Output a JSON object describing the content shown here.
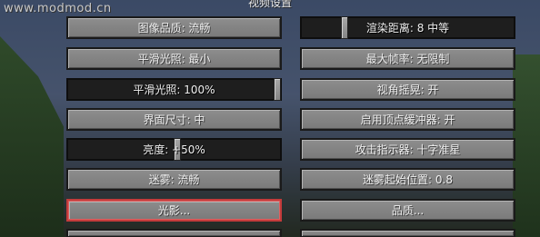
{
  "watermark": "www.modmod.cn",
  "screen_title": "视频设置",
  "left_column": [
    {
      "type": "button",
      "label": "图像品质: 流畅"
    },
    {
      "type": "button",
      "label": "平滑光照: 最小"
    },
    {
      "type": "slider",
      "label": "平滑光照: 100%",
      "level": 1.0
    },
    {
      "type": "button",
      "label": "界面尺寸: 中"
    },
    {
      "type": "slider",
      "label": "亮度: +50%",
      "level": 0.5
    },
    {
      "type": "button",
      "label": "迷雾: 流畅"
    },
    {
      "type": "button",
      "label": "光影...",
      "focused": true
    },
    {
      "type": "button",
      "label": ""
    }
  ],
  "right_column": [
    {
      "type": "slider",
      "label": "渲染距离: 8 中等",
      "level": 0.22
    },
    {
      "type": "button",
      "label": "最大帧率: 无限制"
    },
    {
      "type": "button",
      "label": "视角摇晃: 开"
    },
    {
      "type": "button",
      "label": "启用顶点缓冲器: 开"
    },
    {
      "type": "button",
      "label": "攻击指示器: 十字准星"
    },
    {
      "type": "button",
      "label": "迷雾起始位置: 0.8"
    },
    {
      "type": "button",
      "label": "品质..."
    },
    {
      "type": "button",
      "label": ""
    }
  ],
  "colors": {
    "focus_border": "#c33b3b"
  }
}
